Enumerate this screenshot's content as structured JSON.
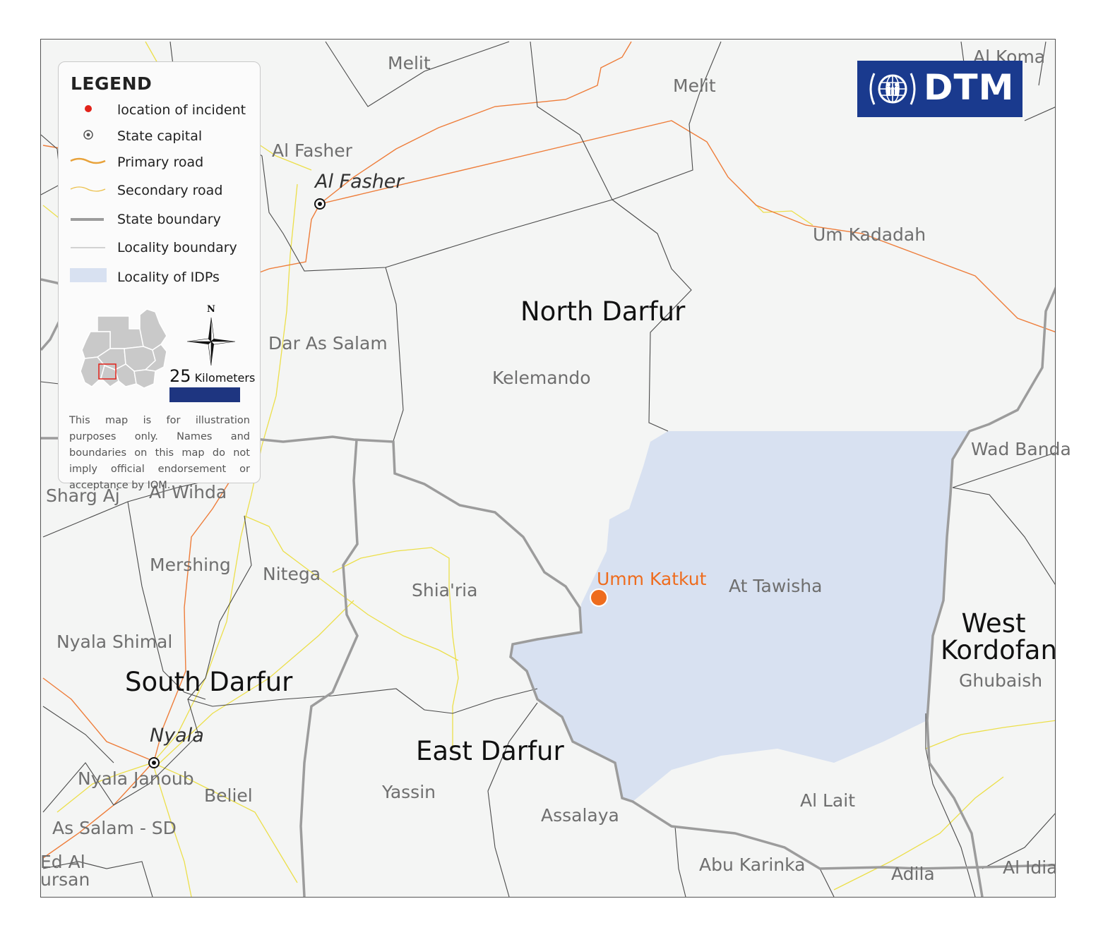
{
  "colors": {
    "background": "#f4f5f4",
    "idp_fill": "#d8e1f1",
    "state_boundary": "#9c9c9c",
    "locality_boundary": "#4a4a4a",
    "primary_road": "#ee7d3a",
    "secondary_road": "#ecdf4a",
    "incident": "#ee6c1e",
    "dtm_blue": "#1a3a8e"
  },
  "logo": {
    "text": "DTM"
  },
  "legend": {
    "title": "LEGEND",
    "items": [
      {
        "label": "location of incident",
        "symbol": "red-dot-icon"
      },
      {
        "label": "State capital",
        "symbol": "state-capital-icon"
      },
      {
        "label": "Primary road",
        "symbol": "primary-road-line"
      },
      {
        "label": "Secondary road",
        "symbol": "secondary-road-line"
      },
      {
        "label": "State boundary",
        "symbol": "state-boundary-line"
      },
      {
        "label": "Locality boundary",
        "symbol": "locality-boundary-line"
      },
      {
        "label": "Locality of IDPs",
        "symbol": "idp-locality-swatch"
      }
    ],
    "north_label": "N",
    "scale_value": "25",
    "scale_unit": "Kilometers",
    "disclaimer": "This map is for illustration purposes only. Names and boundaries on this map do not imply official endorsement or acceptance by IOM."
  },
  "states": [
    "North Darfur",
    "South Darfur",
    "East Darfur",
    "West Kordofan"
  ],
  "capitals": [
    "Al Fasher",
    "Nyala"
  ],
  "incident": {
    "label": "Umm Katkut"
  },
  "localities": [
    "Melit",
    "Melit",
    "Al Koma",
    "Al Fasher",
    "Um Kadadah",
    "Dar As Salam",
    "Kelemando",
    "Wad Banda",
    "Sharg Aj",
    "Al Wihda",
    "Mershing",
    "Nitega",
    "Shia'ria",
    "At Tawisha",
    "Nyala Shimal",
    "Ghubaish",
    "Nyala Janoub",
    "Beliel",
    "Yassin",
    "Assalaya",
    "Al Lait",
    "As Salam - SD",
    "Abu Karinka",
    "Adila",
    "Al Idia",
    "Ed Al",
    "ursan"
  ]
}
